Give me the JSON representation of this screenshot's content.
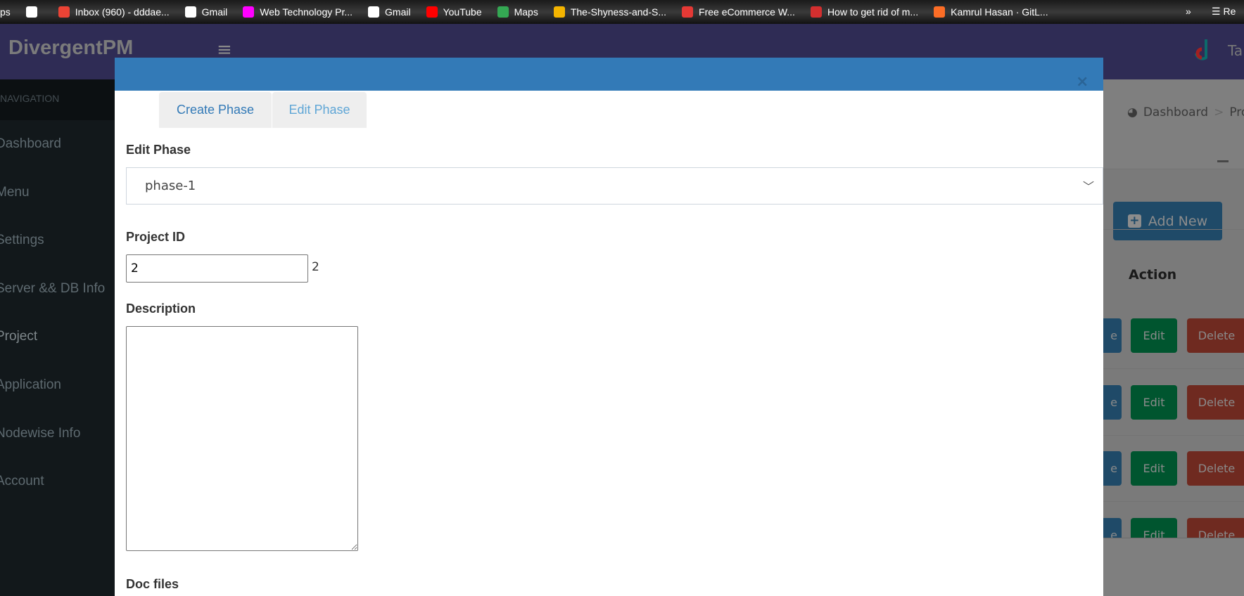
{
  "bookmarks": [
    {
      "label": "ps",
      "icon": "apps-icon",
      "color": "#000000"
    },
    {
      "label": "",
      "icon": "mm-icon",
      "color": "#ffffff"
    },
    {
      "label": "Inbox (960) - dddae...",
      "icon": "gmail-icon",
      "color": "#ea4335"
    },
    {
      "label": "Gmail",
      "icon": "google-icon",
      "color": "#ffffff"
    },
    {
      "label": "Web Technology Pr...",
      "icon": "ad-icon",
      "color": "#ff00ff"
    },
    {
      "label": "Gmail",
      "icon": "google-icon",
      "color": "#ffffff"
    },
    {
      "label": "YouTube",
      "icon": "youtube-icon",
      "color": "#ff0000"
    },
    {
      "label": "Maps",
      "icon": "maps-icon",
      "color": "#34a853"
    },
    {
      "label": "The-Shyness-and-S...",
      "icon": "colorgrid-icon",
      "color": "#f4b400"
    },
    {
      "label": "Free eCommerce W...",
      "icon": "ecommerce-icon",
      "color": "#e53935"
    },
    {
      "label": "How to get rid of m...",
      "icon": "in-icon",
      "color": "#d32f2f"
    },
    {
      "label": "Kamrul Hasan · GitL...",
      "icon": "gitlab-icon",
      "color": "#fc6d26"
    }
  ],
  "bookmarks_more": "»",
  "reading_list": "Re",
  "header": {
    "logo": "DivergentPM",
    "menu_icon": "≡",
    "user": "Ta"
  },
  "sidebar": {
    "heading": "NAVIGATION",
    "items": [
      {
        "label": "Dashboard"
      },
      {
        "label": "Menu"
      },
      {
        "label": "Settings"
      },
      {
        "label": "Server && DB Info"
      },
      {
        "label": "Project",
        "active": true
      },
      {
        "label": "Application"
      },
      {
        "label": "Nodewise Info"
      },
      {
        "label": "Account"
      }
    ]
  },
  "breadcrumb": {
    "home": "Dashboard",
    "sep": ">",
    "current": "Pro"
  },
  "content": {
    "add_new": "Add New",
    "action_header": "Action",
    "rows": [
      {
        "view": "e",
        "edit": "Edit",
        "delete": "Delete"
      },
      {
        "view": "e",
        "edit": "Edit",
        "delete": "Delete"
      },
      {
        "view": "e",
        "edit": "Edit",
        "delete": "Delete"
      },
      {
        "view": "e",
        "edit": "Edit",
        "delete": "Delete"
      }
    ]
  },
  "modal": {
    "close": "×",
    "tabs": [
      "Create Phase",
      "Edit Phase"
    ],
    "edit_phase_label": "Edit Phase",
    "edit_phase_value": "phase-1",
    "project_id_label": "Project ID",
    "project_id_value": "2",
    "project_id_text": "2",
    "description_label": "Description",
    "description_value": "",
    "doc_files_label": "Doc files"
  },
  "colors": {
    "modal_header": "#337ab7",
    "header": "#2f2c55",
    "edit": "#00a65a",
    "delete": "#dd4b39",
    "primary": "#3c8dbc"
  }
}
